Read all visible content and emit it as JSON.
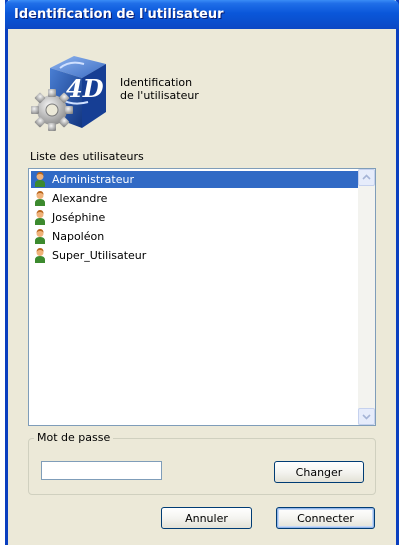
{
  "window": {
    "title": "Identification de l'utilisateur",
    "accent": "#0a57da",
    "background": "#ece9d8"
  },
  "header": {
    "line1": "Identification",
    "line2": "de l'utilisateur",
    "logo_icon": "4d-logo-gear-icon"
  },
  "users": {
    "label": "Liste des utilisateurs",
    "selected_color": "#316ac5",
    "items": [
      {
        "name": "Administrateur",
        "selected": true,
        "icon": "user-icon"
      },
      {
        "name": "Alexandre",
        "selected": false,
        "icon": "user-icon"
      },
      {
        "name": "Joséphine",
        "selected": false,
        "icon": "user-icon"
      },
      {
        "name": "Napoléon",
        "selected": false,
        "icon": "user-icon"
      },
      {
        "name": "Super_Utilisateur",
        "selected": false,
        "icon": "user-icon"
      }
    ]
  },
  "password": {
    "group_label": "Mot de passe",
    "value": "",
    "placeholder": "",
    "change_button": "Changer"
  },
  "actions": {
    "cancel_label": "Annuler",
    "connect_label": "Connecter"
  }
}
